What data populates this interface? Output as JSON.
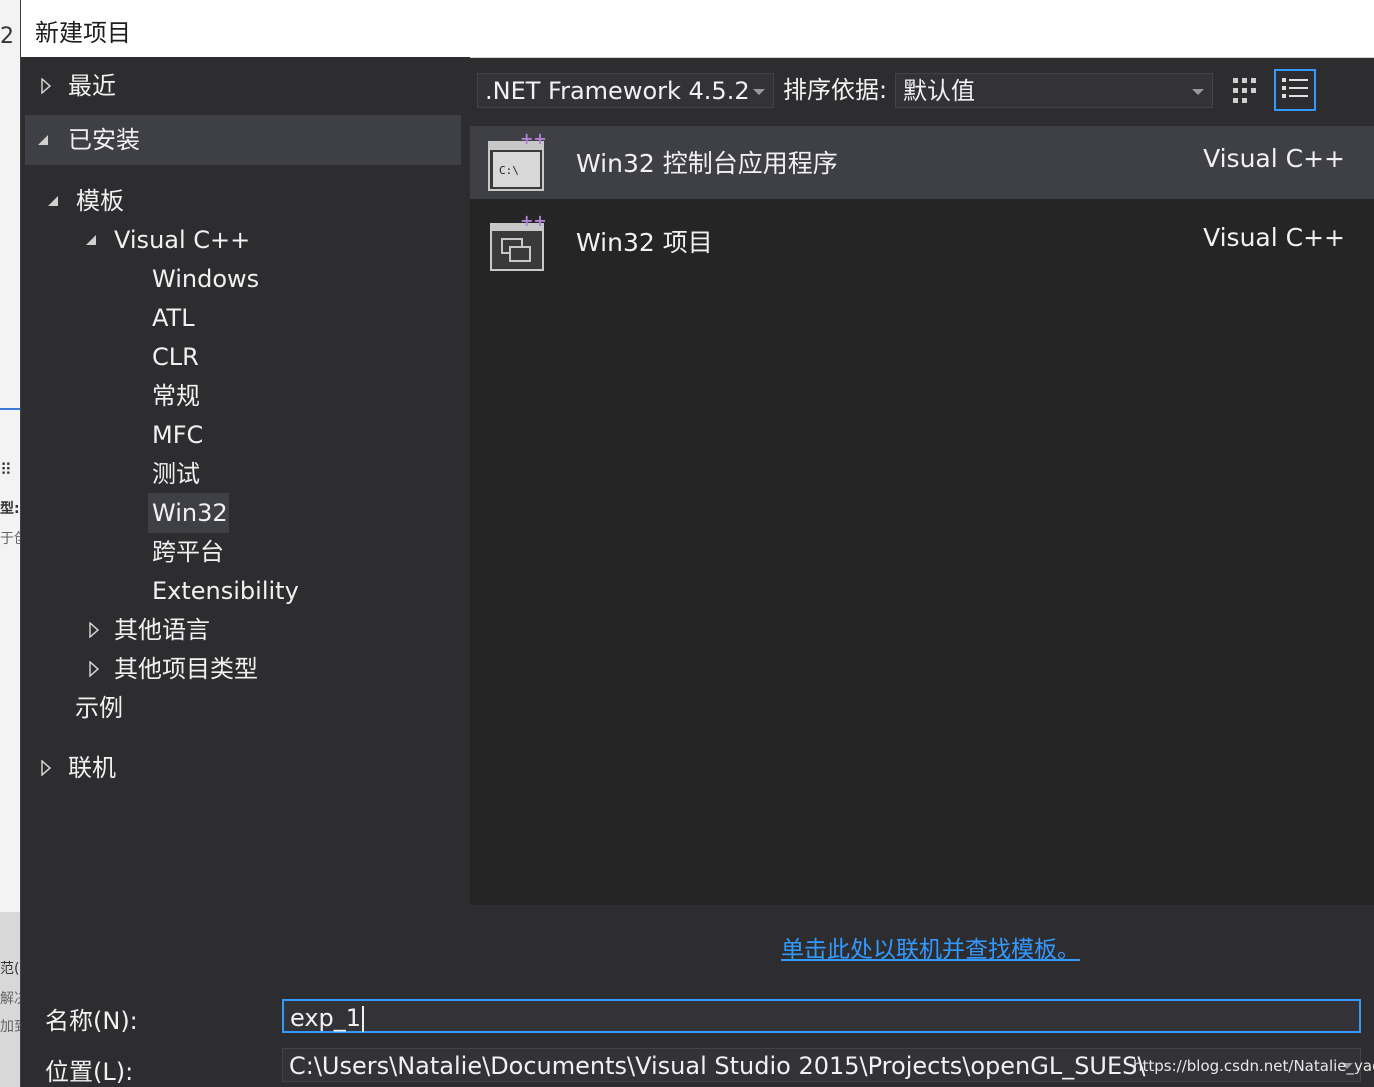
{
  "background": {
    "fragments": [
      "2 扌",
      "型:",
      "于创",
      "范(D",
      "解决",
      "加到"
    ]
  },
  "dialog": {
    "title": "新建项目"
  },
  "tree": {
    "recent": "最近",
    "installed": "已安装",
    "templates": "模板",
    "visual_cpp": "Visual C++",
    "visual_cpp_children": [
      "Windows",
      "ATL",
      "CLR",
      "常规",
      "MFC",
      "测试",
      "Win32",
      "跨平台",
      "Extensibility"
    ],
    "other_languages": "其他语言",
    "other_project_types": "其他项目类型",
    "samples": "示例",
    "online": "联机"
  },
  "toolbar": {
    "framework": ".NET Framework 4.5.2",
    "sort_label": "排序依据:",
    "sort_value": "默认值"
  },
  "templates": [
    {
      "name": "Win32 控制台应用程序",
      "lang": "Visual C++",
      "icon": "console-app-icon",
      "selected": true
    },
    {
      "name": "Win32 项目",
      "lang": "Visual C++",
      "icon": "win32-project-icon",
      "selected": false
    }
  ],
  "online_link": "单击此处以联机并查找模板。",
  "fields": {
    "name_label": "名称(N):",
    "name_value": "exp_1",
    "location_label": "位置(L):",
    "location_value": "C:\\Users\\Natalie\\Documents\\Visual Studio 2015\\Projects\\openGL_SUES\\"
  },
  "watermark": "https://blog.csdn.net/Natalie_yao",
  "colors": {
    "accent": "#3399ff",
    "panel": "#2d2d30",
    "list_bg": "#252526",
    "selection": "#3f3f46",
    "cpp_plus": "#b180d7"
  }
}
